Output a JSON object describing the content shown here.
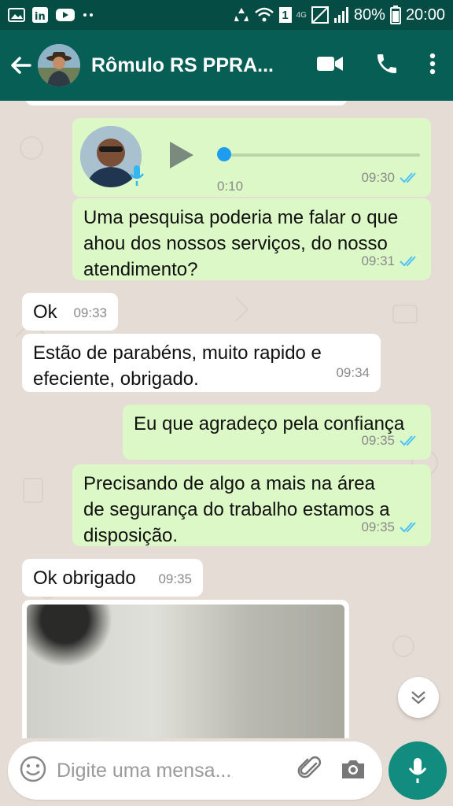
{
  "status_bar": {
    "network": "4G",
    "battery": "80%",
    "time": "20:00",
    "sim_badge": "1"
  },
  "header": {
    "title": "Rômulo RS PPRA...",
    "icons": [
      "back-arrow-icon",
      "video-call-icon",
      "phone-icon",
      "more-vert-icon"
    ]
  },
  "messages": [
    {
      "type": "voice",
      "direction": "out",
      "duration": "0:10",
      "time": "09:30",
      "status": "read"
    },
    {
      "type": "text",
      "direction": "out",
      "text_lines": [
        "Uma pesquisa poderia me falar o que",
        "ahou dos nossos serviços, do nosso",
        "atendimento?"
      ],
      "time": "09:31",
      "status": "read"
    },
    {
      "type": "text",
      "direction": "in",
      "text_lines": [
        "Ok"
      ],
      "time": "09:33"
    },
    {
      "type": "text",
      "direction": "in",
      "text_lines": [
        "Estão de parabéns, muito rapido e",
        "efeciente, obrigado."
      ],
      "time": "09:34"
    },
    {
      "type": "text",
      "direction": "out",
      "text_lines": [
        "Eu que agradeço pela confiança"
      ],
      "time": "09:35",
      "status": "read"
    },
    {
      "type": "text",
      "direction": "out",
      "text_lines": [
        "Precisando de algo a mais na área",
        "de segurança do trabalho estamos a",
        "disposição."
      ],
      "time": "09:35",
      "status": "read"
    },
    {
      "type": "text",
      "direction": "in",
      "text_lines": [
        "Ok obrigado"
      ],
      "time": "09:35"
    },
    {
      "type": "image",
      "direction": "in"
    }
  ],
  "composer": {
    "placeholder": "Digite uma mensa..."
  },
  "colors": {
    "header": "#075e54",
    "status_bar": "#054d44",
    "outgoing_bubble": "#dcf8c6",
    "incoming_bubble": "#ffffff",
    "read_ticks": "#4fc3f7",
    "fab": "#128c7e"
  }
}
